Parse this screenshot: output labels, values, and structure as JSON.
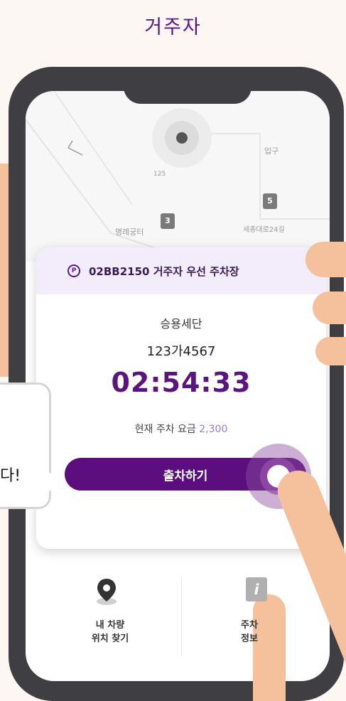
{
  "header": {
    "title": "거주자"
  },
  "map": {
    "labels": [
      "입구",
      "125",
      "명례궁터",
      "세종대로24길"
    ],
    "badges": [
      "3",
      "5"
    ]
  },
  "card": {
    "lot_name": "02BB2150 거주자 우선 주차장",
    "car_type": "승용세단",
    "plate": "123가4567",
    "timer": "02:54:33",
    "fee_label": "현재 주차 요금",
    "fee_amount": "2,300",
    "exit_button": "출차하기"
  },
  "menu": {
    "left": [
      "내 차량",
      "위치 찾기"
    ],
    "right": [
      "주차",
      "정보"
    ]
  },
  "bubble": {
    "text": "다!"
  },
  "colors": {
    "brand": "#5c0e7f",
    "accent_light": "#f3ecfb"
  }
}
